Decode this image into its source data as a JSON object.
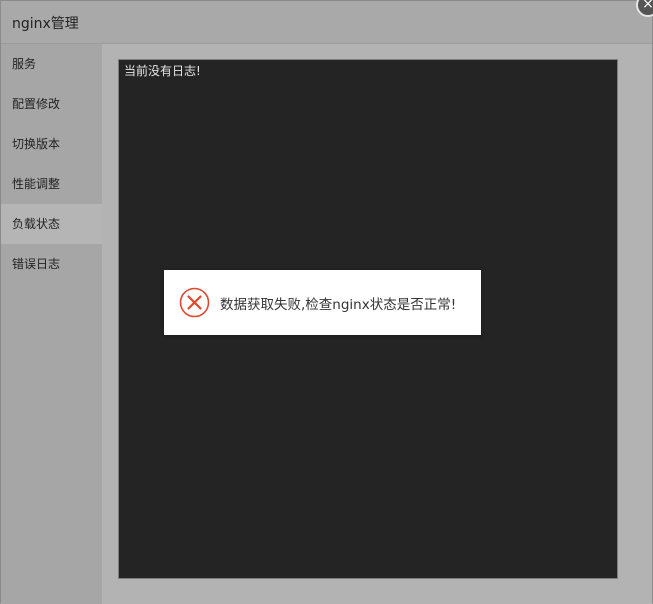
{
  "window": {
    "title": "nginx管理",
    "close_glyph": "×"
  },
  "sidebar": {
    "items": [
      {
        "label": "服务"
      },
      {
        "label": "配置修改"
      },
      {
        "label": "切换版本"
      },
      {
        "label": "性能调整"
      },
      {
        "label": "负载状态",
        "active": true
      },
      {
        "label": "错误日志"
      }
    ]
  },
  "log": {
    "text": "当前没有日志!"
  },
  "dialog": {
    "icon": "error-circle-icon",
    "message": "数据获取失败,检查nginx状态是否正常!"
  },
  "colors": {
    "error": "#e0472c",
    "log_bg": "#242424",
    "overlay": "#b3b3b3"
  }
}
